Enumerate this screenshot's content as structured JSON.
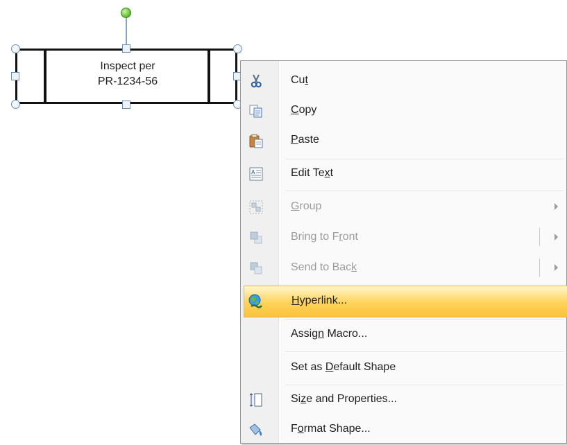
{
  "shape": {
    "text_line1": "Inspect per",
    "text_line2": "PR-1234-56"
  },
  "menu": {
    "cut": {
      "pre": "Cu",
      "u": "t",
      "post": "",
      "icon": "scissors-icon"
    },
    "copy": {
      "pre": "",
      "u": "C",
      "post": "opy",
      "icon": "copy-icon"
    },
    "paste": {
      "pre": "",
      "u": "P",
      "post": "aste",
      "icon": "paste-icon"
    },
    "edit_text": {
      "pre": "Edit Te",
      "u": "x",
      "post": "t",
      "icon": "edit-text-icon"
    },
    "group": {
      "pre": "",
      "u": "G",
      "post": "roup",
      "icon": "group-icon"
    },
    "bring_to_front": {
      "pre": "Bring to F",
      "u": "r",
      "post": "ont",
      "icon": "bring-to-front-icon"
    },
    "send_to_back": {
      "pre": "Send to Bac",
      "u": "k",
      "post": "",
      "icon": "send-to-back-icon"
    },
    "hyperlink": {
      "pre": "",
      "u": "H",
      "post": "yperlink...",
      "icon": "hyperlink-globe-icon"
    },
    "assign_macro": {
      "pre": "Assig",
      "u": "n",
      "post": " Macro..."
    },
    "set_default": {
      "pre": "Set as ",
      "u": "D",
      "post": "efault Shape"
    },
    "size_props": {
      "pre": "Si",
      "u": "z",
      "post": "e and Properties...",
      "icon": "size-properties-icon"
    },
    "format_shape": {
      "pre": "F",
      "u": "o",
      "post": "rmat Shape...",
      "icon": "format-shape-icon"
    }
  },
  "colors": {
    "highlight": "#ffd35a",
    "disabled_text": "#9b9b9b",
    "rotation_handle": "#6cc43c"
  }
}
